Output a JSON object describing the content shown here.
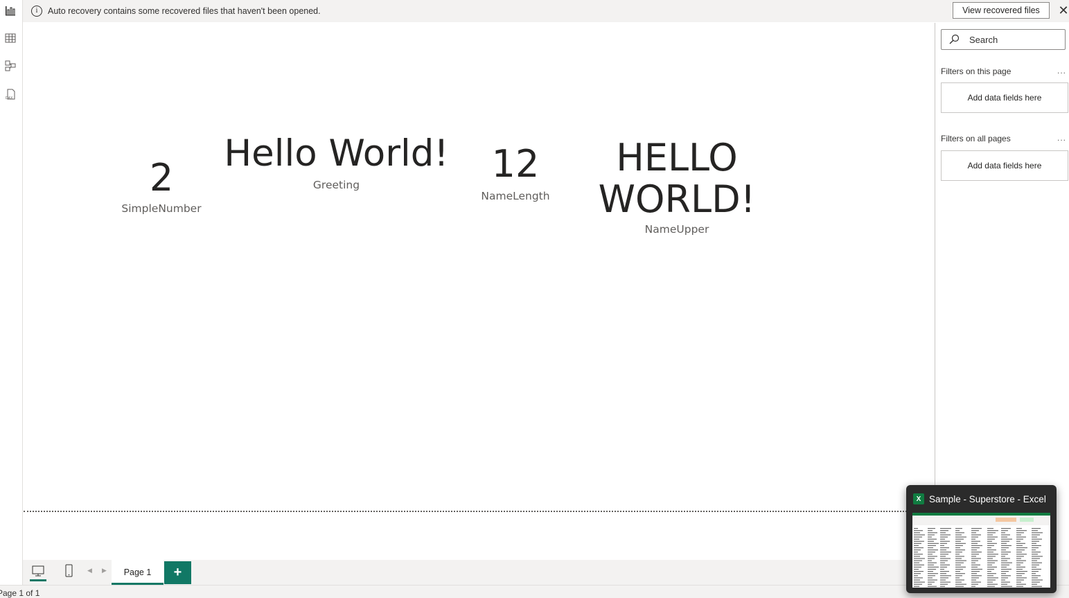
{
  "left_rail": {
    "items": [
      {
        "name": "report-view",
        "icon": "bar-chart-icon"
      },
      {
        "name": "table-view",
        "icon": "table-icon"
      },
      {
        "name": "model-view",
        "icon": "model-icon"
      },
      {
        "name": "dax-query-view",
        "icon": "dax-icon"
      }
    ]
  },
  "infobar": {
    "icon": "info-icon",
    "glyph": "i",
    "message": "Auto recovery contains some recovered files that haven't been opened.",
    "button_label": "View recovered files",
    "close_glyph": "✕"
  },
  "cards": [
    {
      "value": "2",
      "label": "SimpleNumber"
    },
    {
      "value": "Hello World!",
      "label": "Greeting"
    },
    {
      "value": "12",
      "label": "NameLength"
    },
    {
      "value": "HELLO WORLD!",
      "label": "NameUpper"
    }
  ],
  "filters_pane": {
    "search_placeholder": "Search",
    "sections": [
      {
        "title": "Filters on this page",
        "more": "...",
        "dropzone": "Add data fields here"
      },
      {
        "title": "Filters on all pages",
        "more": "...",
        "dropzone": "Add data fields here"
      }
    ]
  },
  "tabbar": {
    "page_tab_label": "Page 1",
    "add_label": "+"
  },
  "status_bar": {
    "page_indicator": "Page 1 of 1"
  },
  "taskbar_preview": {
    "app_icon_text": "X",
    "title": "Sample - Superstore - Excel"
  },
  "colors": {
    "accent": "#117865",
    "excel": "#107c41",
    "infobar_bg": "#f3f2f1"
  }
}
